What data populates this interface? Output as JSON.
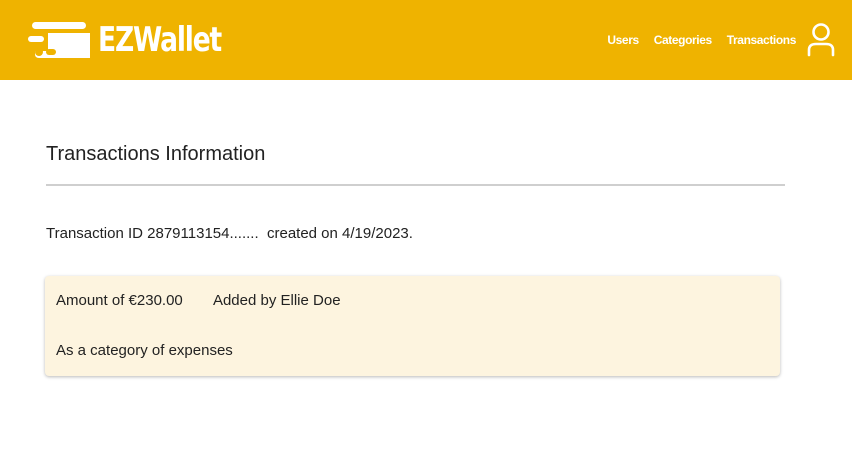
{
  "header": {
    "brand_name": "EZWallet",
    "background_color": "#efb300",
    "nav": [
      {
        "label": "Users"
      },
      {
        "label": "Categories"
      },
      {
        "label": "Transactions"
      }
    ],
    "account_icon": "person-icon"
  },
  "main": {
    "title": "Transactions Information",
    "transaction": {
      "id_label": "Transaction ID",
      "id_value": "2879113154.......",
      "created_label": "created on",
      "created_date": "4/19/2023."
    },
    "card": {
      "background_color": "#fdf4df",
      "amount_label": "Amount of",
      "amount_value": "€230.00",
      "added_by_label": "Added by",
      "added_by_name": "Ellie Doe",
      "category_label": "As a category of",
      "category_value": "expenses"
    }
  }
}
